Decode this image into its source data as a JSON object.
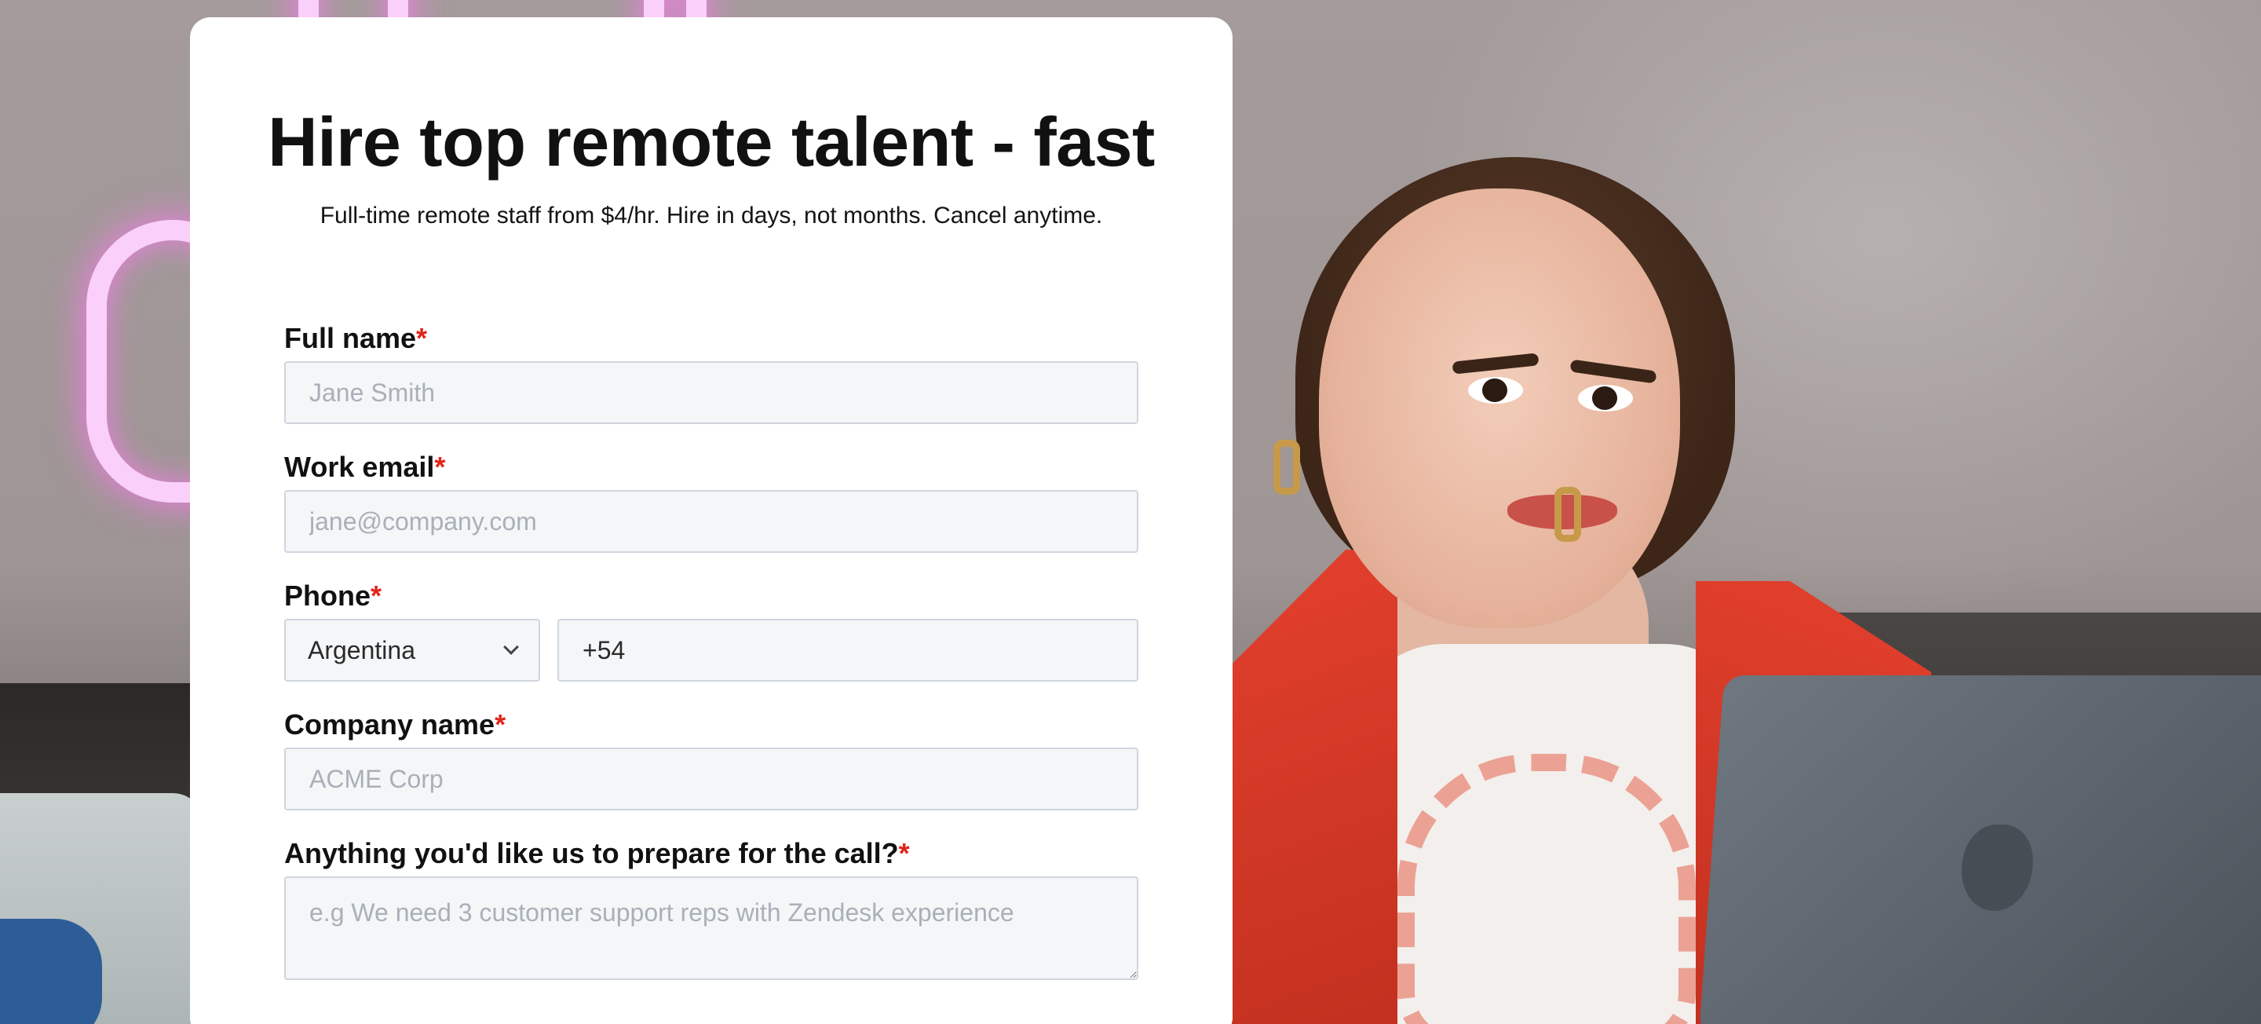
{
  "header": {
    "title": "Hire top remote talent - fast",
    "subtitle": "Full-time remote staff from $4/hr. Hire in days, not months. Cancel anytime."
  },
  "form": {
    "required_marker": "*",
    "full_name": {
      "label": "Full name",
      "placeholder": "Jane Smith"
    },
    "work_email": {
      "label": "Work email",
      "placeholder": "jane@company.com"
    },
    "phone": {
      "label": "Phone",
      "country": "Argentina",
      "value": "+54"
    },
    "company_name": {
      "label": "Company name",
      "placeholder": "ACME Corp"
    },
    "prepare": {
      "label": "Anything you'd like us to prepare for the call?",
      "placeholder": "e.g We need 3 customer support reps with Zendesk experience"
    }
  },
  "colors": {
    "required": "#e2231a",
    "field_bg": "#f4f6f8",
    "field_border": "#cfd6de",
    "jacket": "#e3402d"
  },
  "icons": {
    "select_arrow": "chevron-down-icon"
  }
}
